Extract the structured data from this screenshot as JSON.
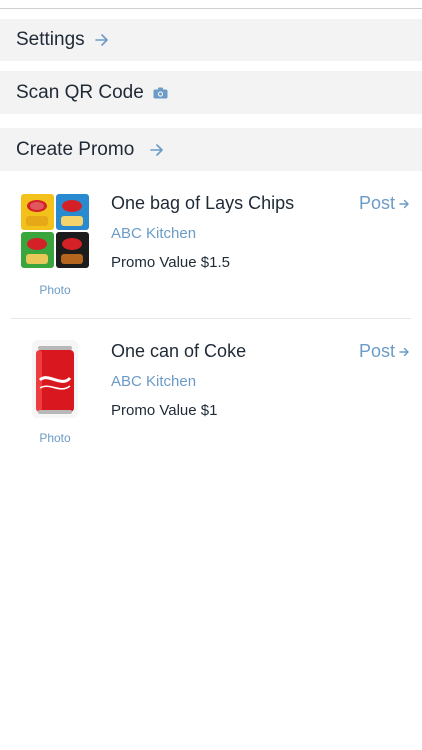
{
  "menu": {
    "settings_label": "Settings",
    "scan_label": "Scan QR Code",
    "create_label": "Create Promo"
  },
  "promos": [
    {
      "title": "One bag of Lays Chips",
      "vendor": "ABC Kitchen",
      "value": "Promo Value $1.5",
      "photo_label": "Photo",
      "post_label": "Post"
    },
    {
      "title": "One can of Coke",
      "vendor": "ABC Kitchen",
      "value": "Promo Value $1",
      "photo_label": "Photo",
      "post_label": "Post"
    }
  ],
  "colors": {
    "accent": "#6b9bc7",
    "text": "#1f2a36",
    "row_bg": "#f3f3f3"
  }
}
